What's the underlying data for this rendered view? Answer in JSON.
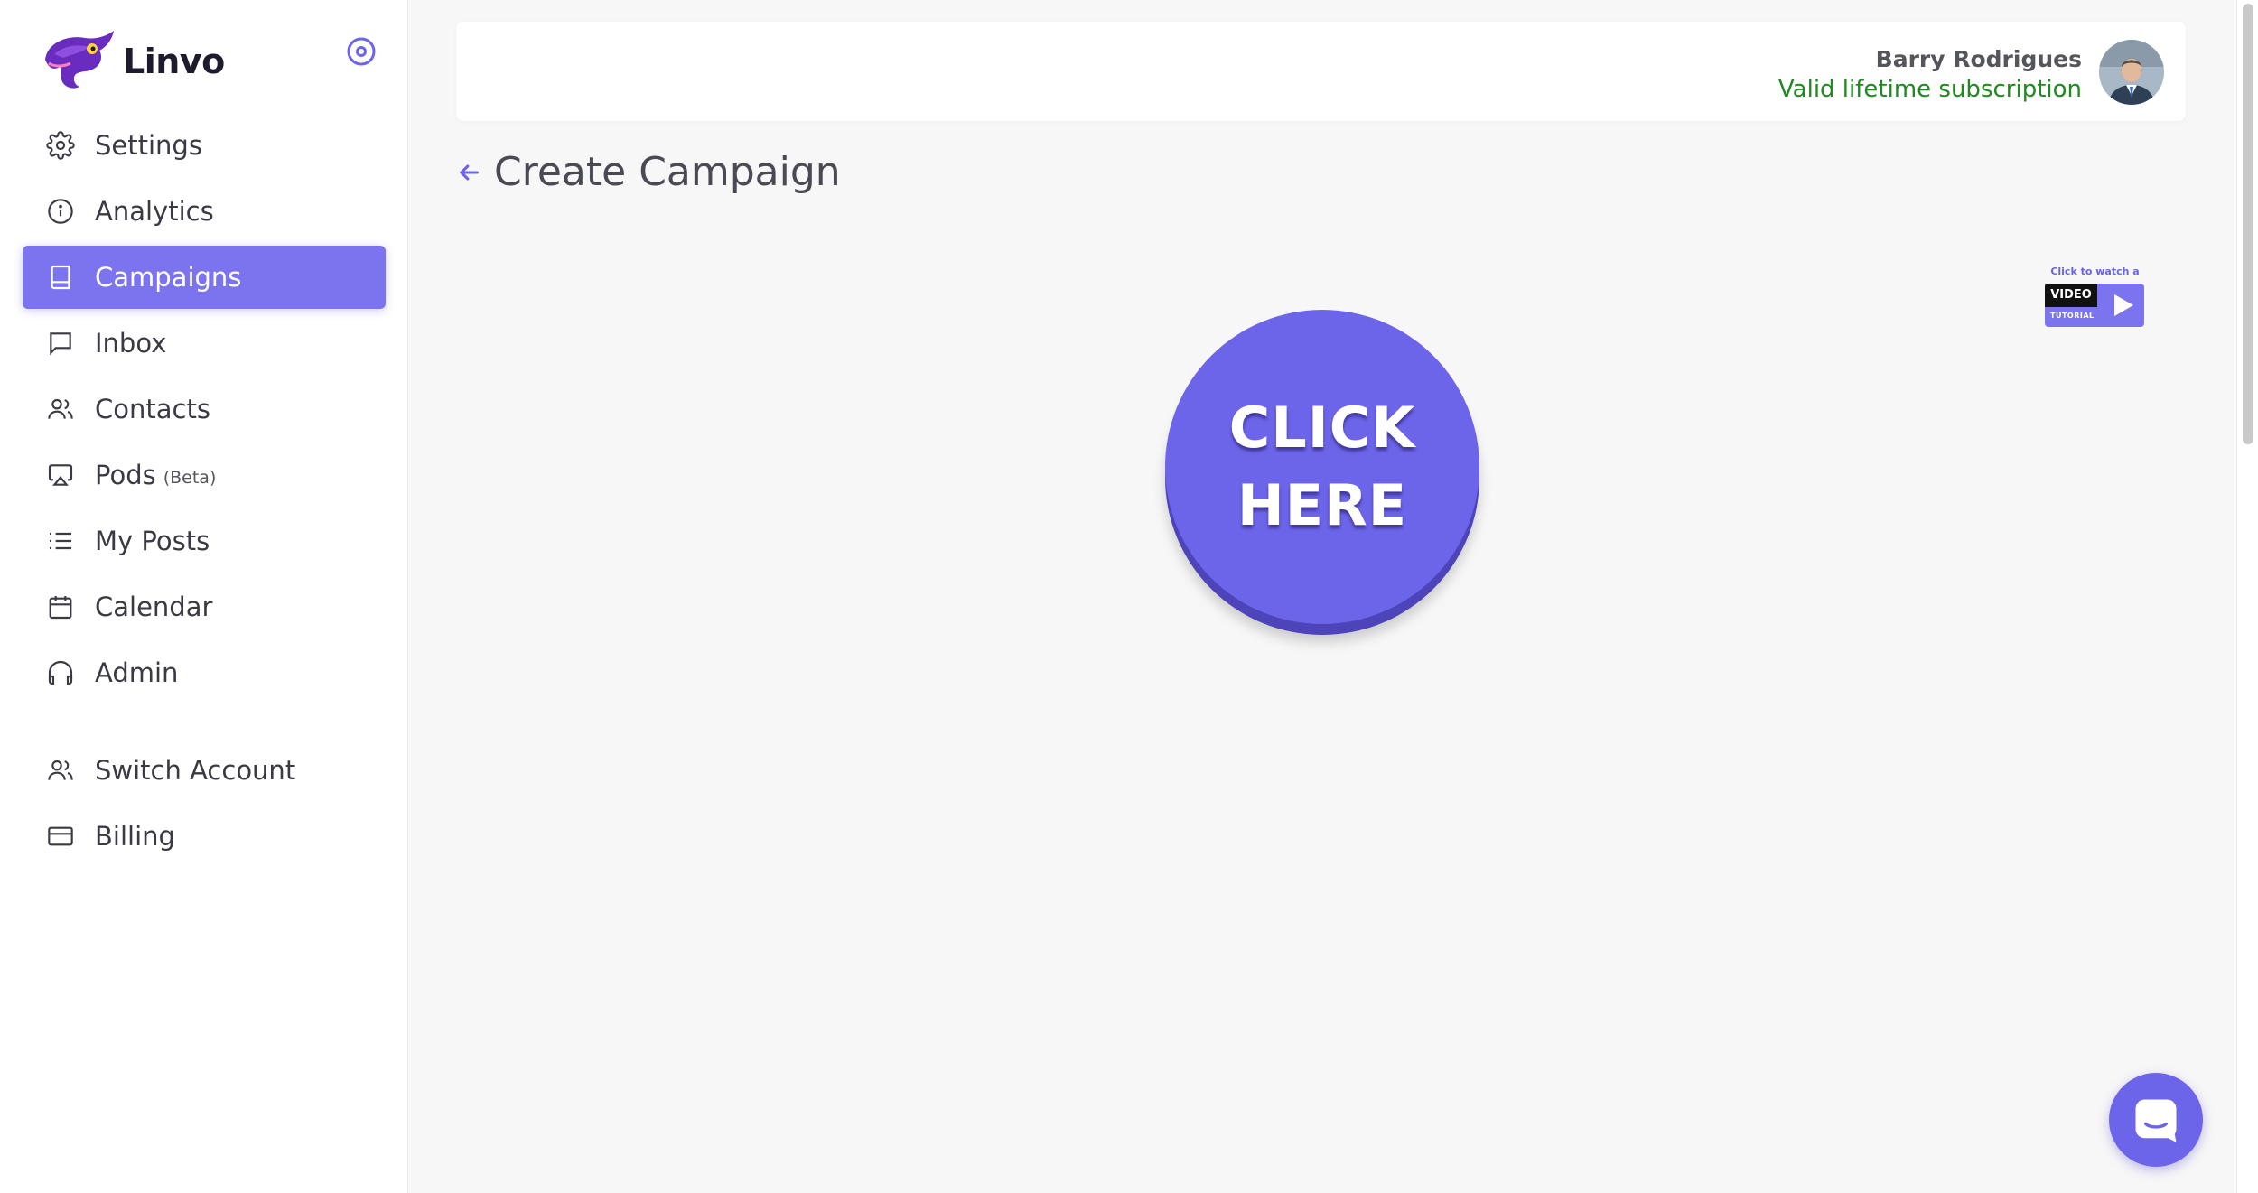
{
  "brand": {
    "name": "Linvo"
  },
  "sidebar": {
    "items": [
      {
        "label": "Settings",
        "icon": "gear-icon"
      },
      {
        "label": "Analytics",
        "icon": "info-circle-icon"
      },
      {
        "label": "Campaigns",
        "icon": "book-icon",
        "active": true
      },
      {
        "label": "Inbox",
        "icon": "chat-bubble-icon"
      },
      {
        "label": "Contacts",
        "icon": "users-icon"
      },
      {
        "label": "Pods",
        "badge": "(Beta)",
        "icon": "airplay-icon"
      },
      {
        "label": "My Posts",
        "icon": "list-icon"
      },
      {
        "label": "Calendar",
        "icon": "calendar-icon"
      },
      {
        "label": "Admin",
        "icon": "headphones-icon"
      }
    ],
    "secondary": [
      {
        "label": "Switch Account",
        "icon": "users-icon"
      },
      {
        "label": "Billing",
        "icon": "credit-card-icon"
      }
    ]
  },
  "header": {
    "user_name": "Barry Rodrigues",
    "subscription": "Valid lifetime subscription"
  },
  "page": {
    "title": "Create Campaign",
    "cta_line1": "CLICK",
    "cta_line2": "HERE"
  },
  "video_badge": {
    "caption": "Click to watch a",
    "label": "VIDEO",
    "sub": "TUTORIAL"
  },
  "colors": {
    "accent": "#6d65e9",
    "active_nav": "#7b74ee",
    "subscription_green": "#1f8a1f"
  }
}
